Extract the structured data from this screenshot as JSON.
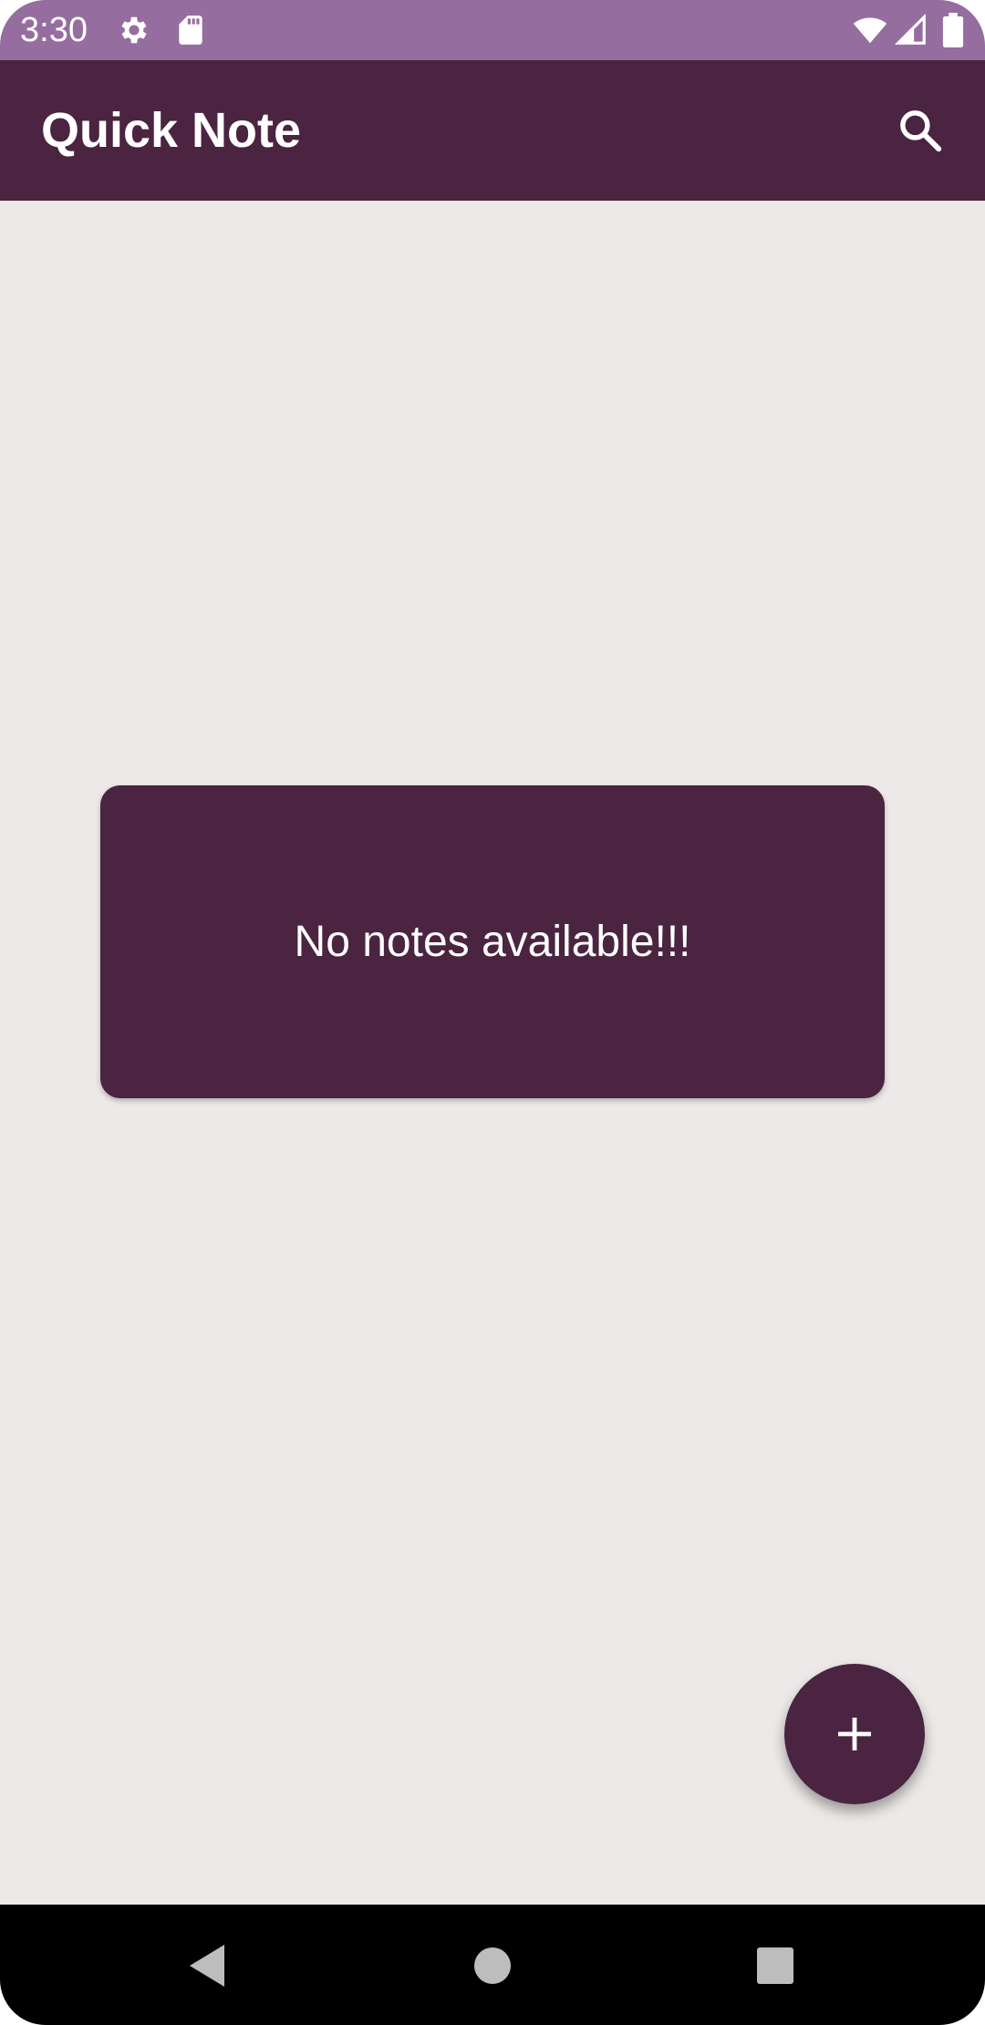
{
  "status_bar": {
    "time": "3:30",
    "icons": [
      "settings-gear-icon",
      "sd-card-icon",
      "wifi-icon",
      "signal-icon",
      "battery-icon"
    ],
    "background": "#966d9f"
  },
  "app_bar": {
    "title": "Quick Note",
    "action_icon": "search-icon",
    "background": "#4a2440"
  },
  "main": {
    "empty_message": "No notes available!!!",
    "background": "#ede9e9",
    "card_color": "#4a2440"
  },
  "fab": {
    "icon": "add-icon",
    "color": "#4a2440"
  },
  "nav_bar": {
    "buttons": [
      "back-icon",
      "home-icon",
      "recents-icon"
    ],
    "icon_color": "#bdbdbd"
  }
}
